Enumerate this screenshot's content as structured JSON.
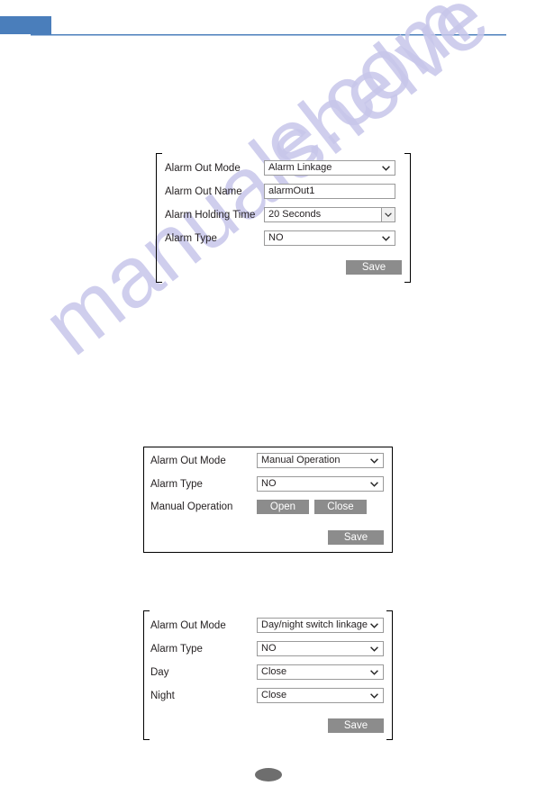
{
  "header": {
    "tab_label": "",
    "accent_color": "#4a7ebb"
  },
  "watermark": {
    "line1": "manualshelve",
    "line2": "e.com",
    "color": "#c7c6ea"
  },
  "panels": [
    {
      "id": "alarm-linkage-panel",
      "border_style": "bracket",
      "rows": [
        {
          "label": "Alarm Out Mode",
          "control": "select",
          "value": "Alarm Linkage"
        },
        {
          "label": "Alarm Out Name",
          "control": "text",
          "value": "alarmOut1"
        },
        {
          "label": "Alarm Holding Time",
          "control": "select-boxed",
          "value": "20 Seconds"
        },
        {
          "label": "Alarm Type",
          "control": "select",
          "value": "NO"
        }
      ],
      "save_label": "Save"
    },
    {
      "id": "manual-operation-panel",
      "border_style": "rect",
      "rows": [
        {
          "label": "Alarm Out Mode",
          "control": "select",
          "value": "Manual Operation"
        },
        {
          "label": "Alarm Type",
          "control": "select",
          "value": "NO"
        },
        {
          "label": "Manual Operation",
          "control": "buttons",
          "buttons": [
            "Open",
            "Close"
          ]
        }
      ],
      "save_label": "Save"
    },
    {
      "id": "day-night-switch-panel",
      "border_style": "bracket",
      "rows": [
        {
          "label": "Alarm Out Mode",
          "control": "select",
          "value": "Day/night switch linkage"
        },
        {
          "label": "Alarm Type",
          "control": "select",
          "value": "NO"
        },
        {
          "label": "Day",
          "control": "select",
          "value": "Close"
        },
        {
          "label": "Night",
          "control": "select",
          "value": "Close"
        }
      ],
      "save_label": "Save"
    }
  ],
  "footer": {
    "page_marker": ""
  }
}
